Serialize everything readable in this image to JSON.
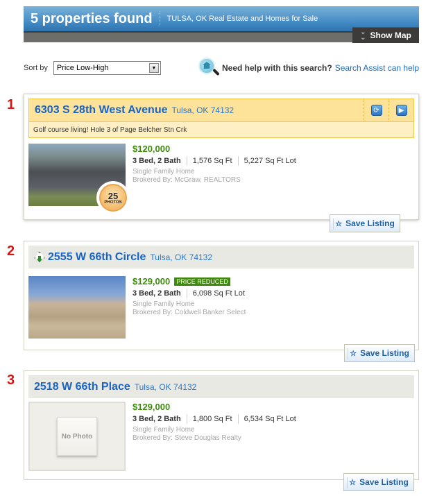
{
  "header": {
    "title": "5 properties found",
    "subtitle": "TULSA, OK Real Estate and Homes for Sale",
    "show_map_label": "Show Map"
  },
  "sort": {
    "label": "Sort by",
    "selected": "Price Low-High"
  },
  "help": {
    "question": "Need help with this search?",
    "link": "Search Assist can help"
  },
  "listings": [
    {
      "number": "1",
      "address": "6303 S 28th West Avenue",
      "city": "Tulsa, OK 74132",
      "tagline": "Golf course living! Hole 3 of Page Belcher Stn Crk",
      "price": "$120,000",
      "beds_baths": "3 Bed, 2 Bath",
      "sqft": "1,576 Sq Ft",
      "lot": "5,227 Sq Ft Lot",
      "type": "Single Family Home",
      "broker": "Brokered By: McGraw, REALTORS",
      "photo_count": "25",
      "photo_label": "PHOTOS",
      "save_label": "Save Listing",
      "featured": true
    },
    {
      "number": "2",
      "address": "2555 W 66th Circle",
      "city": "Tulsa, OK 74132",
      "price": "$129,000",
      "badge": "PRICE REDUCED",
      "beds_baths": "3 Bed, 2 Bath",
      "lot": "6,098 Sq Ft Lot",
      "type": "Single Family Home",
      "broker": "Brokered By: Coldwell Banker Select",
      "save_label": "Save Listing"
    },
    {
      "number": "3",
      "address": "2518 W 66th Place",
      "city": "Tulsa, OK 74132",
      "price": "$129,000",
      "beds_baths": "3 Bed, 2 Bath",
      "sqft": "1,800 Sq Ft",
      "lot": "6,534 Sq Ft Lot",
      "type": "Single Family Home",
      "broker": "Brokered By: Steve Douglas Realty",
      "no_photo_label": "No Photo",
      "save_label": "Save Listing"
    }
  ],
  "colors": {
    "header_blue": "#3f87c2",
    "link_blue": "#1863c4",
    "price_green": "#3d8a0d",
    "number_red": "#e0110f",
    "featured_yellow": "#fde29a"
  }
}
